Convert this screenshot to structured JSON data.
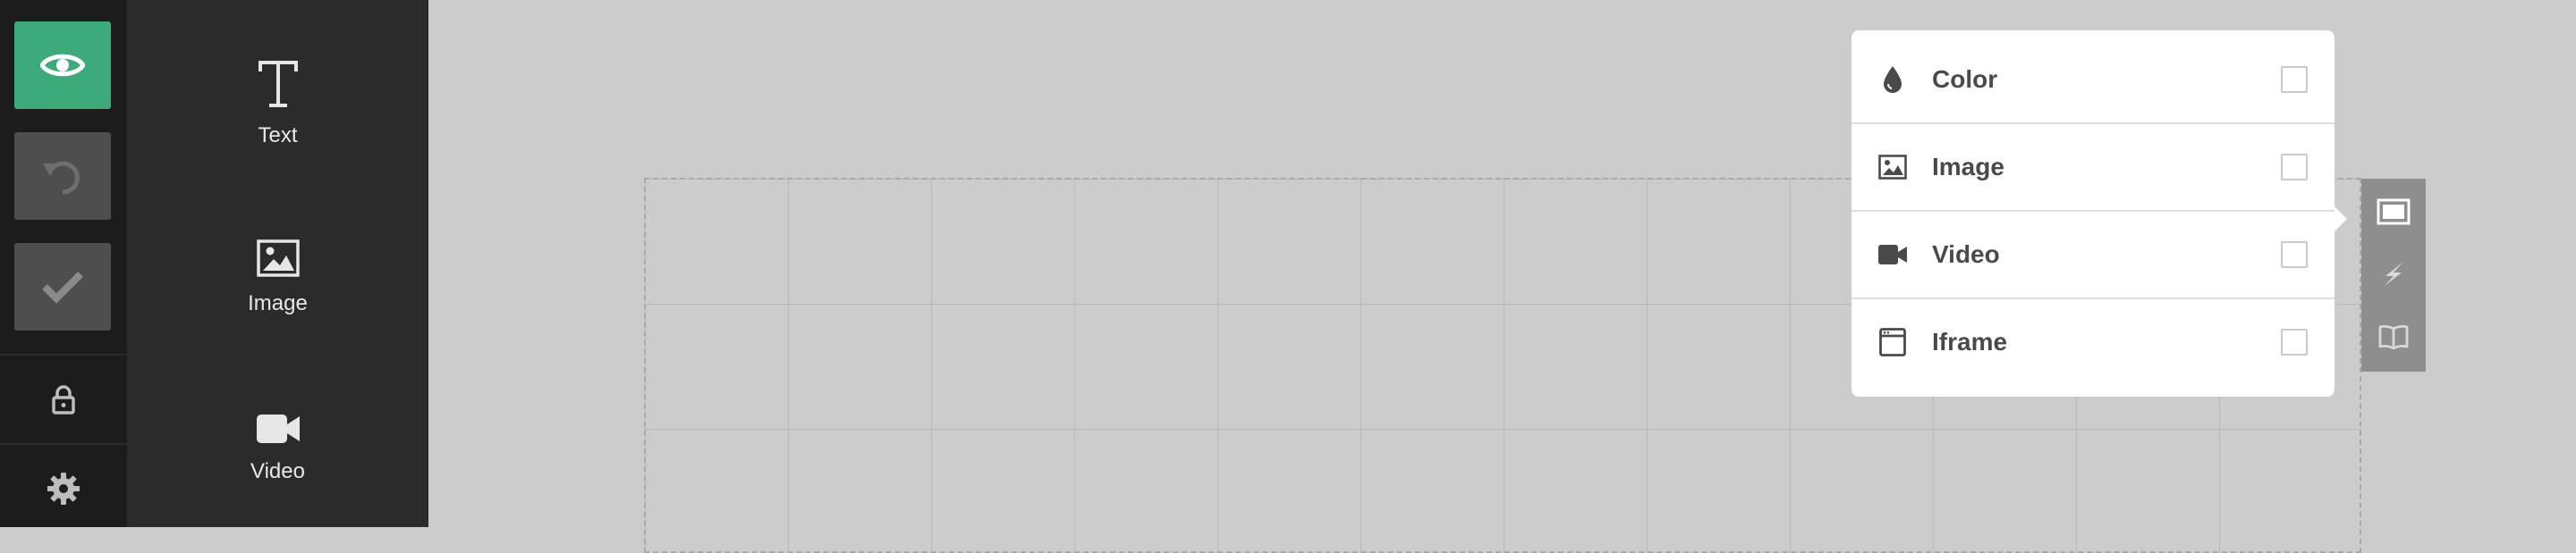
{
  "toolbar": {
    "preview": "preview",
    "undo": "undo",
    "save": "save",
    "lock": "lock",
    "settings": "settings"
  },
  "palette": {
    "items": [
      {
        "label": "Text",
        "icon": "text-icon"
      },
      {
        "label": "Image",
        "icon": "image-icon"
      },
      {
        "label": "Video",
        "icon": "video-icon"
      }
    ]
  },
  "background_menu": {
    "items": [
      {
        "label": "Color",
        "icon": "drop-icon",
        "checked": false
      },
      {
        "label": "Image",
        "icon": "image-icon",
        "checked": false
      },
      {
        "label": "Video",
        "icon": "video-camera-icon",
        "checked": false
      },
      {
        "label": "Iframe",
        "icon": "browser-window-icon",
        "checked": false
      }
    ]
  },
  "side_panel": {
    "buttons": [
      "background-icon",
      "lightning-icon",
      "book-icon"
    ]
  },
  "colors": {
    "accent": "#3daa7a",
    "toolbar_bg": "#1c1c1c",
    "palette_bg": "#2b2b2b",
    "canvas_bg": "#cccccc"
  }
}
